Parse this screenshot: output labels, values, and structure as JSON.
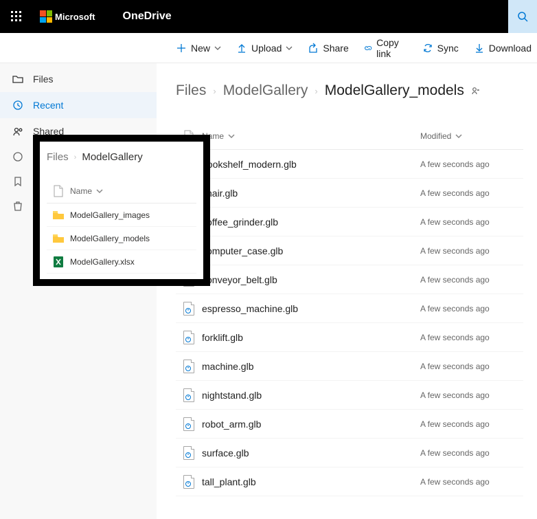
{
  "header": {
    "brand": "Microsoft",
    "app": "OneDrive"
  },
  "commands": {
    "new": "New",
    "upload": "Upload",
    "share": "Share",
    "copylink": "Copy link",
    "sync": "Sync",
    "download": "Download"
  },
  "nav": {
    "files": "Files",
    "recent": "Recent",
    "shared": "Shared"
  },
  "breadcrumb": {
    "root": "Files",
    "mid": "ModelGallery",
    "current": "ModelGallery_models"
  },
  "columns": {
    "name": "Name",
    "modified": "Modified"
  },
  "files": [
    {
      "name": "bookshelf_modern.glb",
      "modified": "A few seconds ago"
    },
    {
      "name": "chair.glb",
      "modified": "A few seconds ago"
    },
    {
      "name": "coffee_grinder.glb",
      "modified": "A few seconds ago"
    },
    {
      "name": "computer_case.glb",
      "modified": "A few seconds ago"
    },
    {
      "name": "conveyor_belt.glb",
      "modified": "A few seconds ago"
    },
    {
      "name": "espresso_machine.glb",
      "modified": "A few seconds ago"
    },
    {
      "name": "forklift.glb",
      "modified": "A few seconds ago"
    },
    {
      "name": "machine.glb",
      "modified": "A few seconds ago"
    },
    {
      "name": "nightstand.glb",
      "modified": "A few seconds ago"
    },
    {
      "name": "robot_arm.glb",
      "modified": "A few seconds ago"
    },
    {
      "name": "surface.glb",
      "modified": "A few seconds ago"
    },
    {
      "name": "tall_plant.glb",
      "modified": "A few seconds ago"
    }
  ],
  "inset": {
    "crumb_root": "Files",
    "crumb_current": "ModelGallery",
    "col_name": "Name",
    "items": [
      {
        "name": "ModelGallery_images",
        "type": "folder"
      },
      {
        "name": "ModelGallery_models",
        "type": "folder"
      },
      {
        "name": "ModelGallery.xlsx",
        "type": "xlsx"
      }
    ]
  }
}
